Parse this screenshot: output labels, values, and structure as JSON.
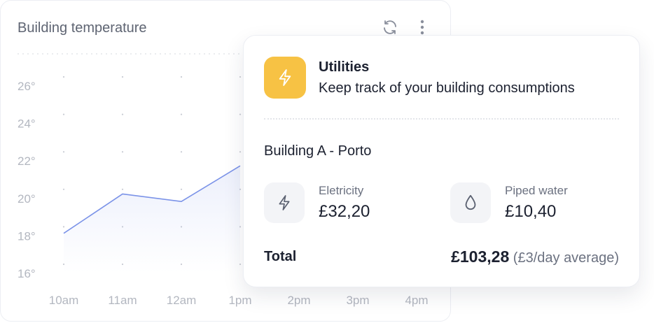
{
  "chart_card": {
    "title": "Building temperature",
    "refresh_icon": "refresh-icon",
    "more_icon": "more-vertical-icon"
  },
  "chart_data": {
    "type": "area",
    "title": "Building temperature",
    "categories": [
      "10am",
      "11am",
      "12am",
      "1pm",
      "2pm",
      "3pm",
      "4pm"
    ],
    "y_tick_labels": [
      "16°",
      "18°",
      "20°",
      "22°",
      "24°",
      "26°"
    ],
    "y_ticks": [
      16,
      18,
      20,
      22,
      24,
      26
    ],
    "ylim": [
      15.5,
      27
    ],
    "series": [
      {
        "values": [
          18.1,
          20.2,
          19.8,
          21.7,
          null,
          null,
          null
        ],
        "color": "#7b93e8"
      }
    ],
    "grid": true
  },
  "utilities": {
    "icon": "lightning-icon",
    "icon_color": "#f7c244",
    "title": "Utilities",
    "subtitle": "Keep track of your building consumptions",
    "building": "Building A - Porto",
    "metrics": [
      {
        "label": "Eletricity",
        "value": "£32,20",
        "icon": "lightning-icon"
      },
      {
        "label": "Piped water",
        "value": "£10,40",
        "icon": "water-drop-icon"
      }
    ],
    "total_label": "Total",
    "total_value": "£103,28",
    "total_note": "(£3/day average)"
  }
}
